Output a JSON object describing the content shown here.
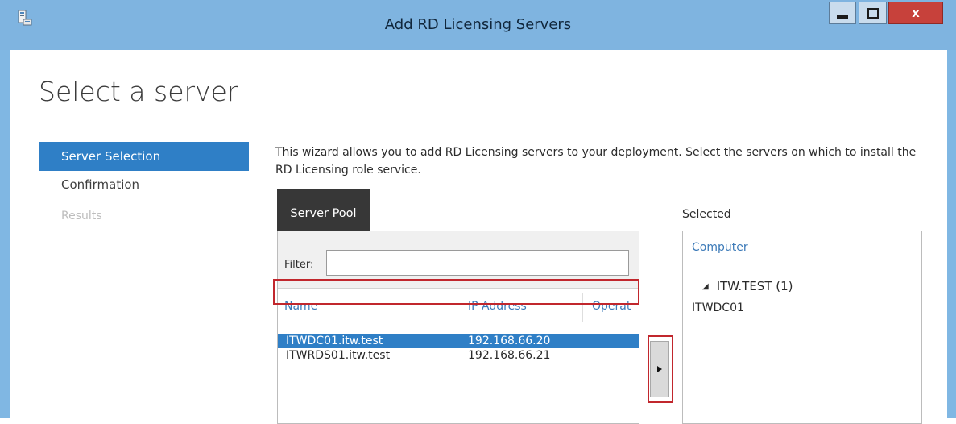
{
  "window": {
    "title": "Add RD Licensing Servers",
    "icons": {
      "app": "server-manager-icon",
      "minimize": "minimize-icon",
      "maximize": "maximize-icon",
      "close": "close-icon"
    },
    "close_glyph": "x",
    "colors": {
      "titlebar": "#7fb4e0",
      "close_button": "#c7413b",
      "accent": "#2f7fc6",
      "highlight_border": "#c1272d"
    }
  },
  "page": {
    "title": "Select a server"
  },
  "nav": {
    "items": [
      {
        "label": "Server Selection",
        "state": "active"
      },
      {
        "label": "Confirmation",
        "state": "normal"
      },
      {
        "label": "Results",
        "state": "disabled"
      }
    ]
  },
  "description": "This wizard allows you to add RD Licensing servers to your deployment. Select the servers on which to install the RD Licensing role service.",
  "server_pool": {
    "tab_label": "Server Pool",
    "filter_label": "Filter:",
    "filter_value": "",
    "columns": [
      "Name",
      "IP Address",
      "Operat"
    ],
    "rows": [
      {
        "name": "ITWDC01.itw.test",
        "ip": "192.168.66.20",
        "selected": true
      },
      {
        "name": "ITWRDS01.itw.test",
        "ip": "192.168.66.21",
        "selected": false
      }
    ]
  },
  "add_button": {
    "glyph": "▸",
    "icon": "right-arrow-icon"
  },
  "selected": {
    "label": "Selected",
    "column": "Computer",
    "group": "ITW.TEST (1)",
    "group_icon": "collapse-triangle-icon",
    "group_glyph": "◢",
    "items": [
      "ITWDC01"
    ]
  }
}
